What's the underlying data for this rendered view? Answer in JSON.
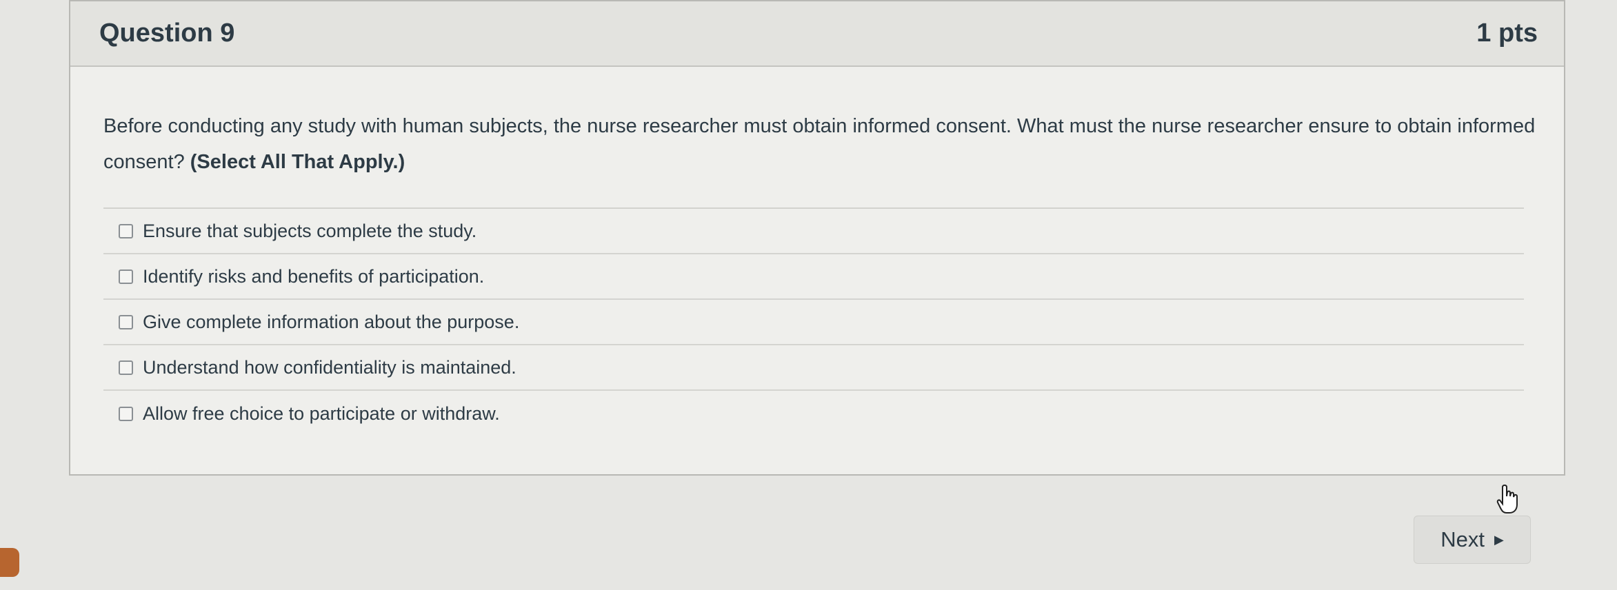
{
  "question": {
    "title": "Question 9",
    "points": "1 pts",
    "prompt": "Before conducting any study with human subjects, the nurse researcher must obtain informed consent.  What must the nurse researcher ensure to obtain informed consent? ",
    "instruction": "(Select All That Apply.)",
    "answers": [
      {
        "label": "Ensure that subjects complete the study.",
        "checked": false
      },
      {
        "label": "Identify risks and benefits of participation.",
        "checked": false
      },
      {
        "label": "Give complete information about the purpose.",
        "checked": false
      },
      {
        "label": "Understand how confidentiality is maintained.",
        "checked": false
      },
      {
        "label": "Allow free choice to participate or withdraw.",
        "checked": false
      }
    ]
  },
  "navigation": {
    "next_label": "Next",
    "next_icon": "triangle-right-icon"
  },
  "icons": {
    "cursor": "hand-pointer-icon"
  }
}
